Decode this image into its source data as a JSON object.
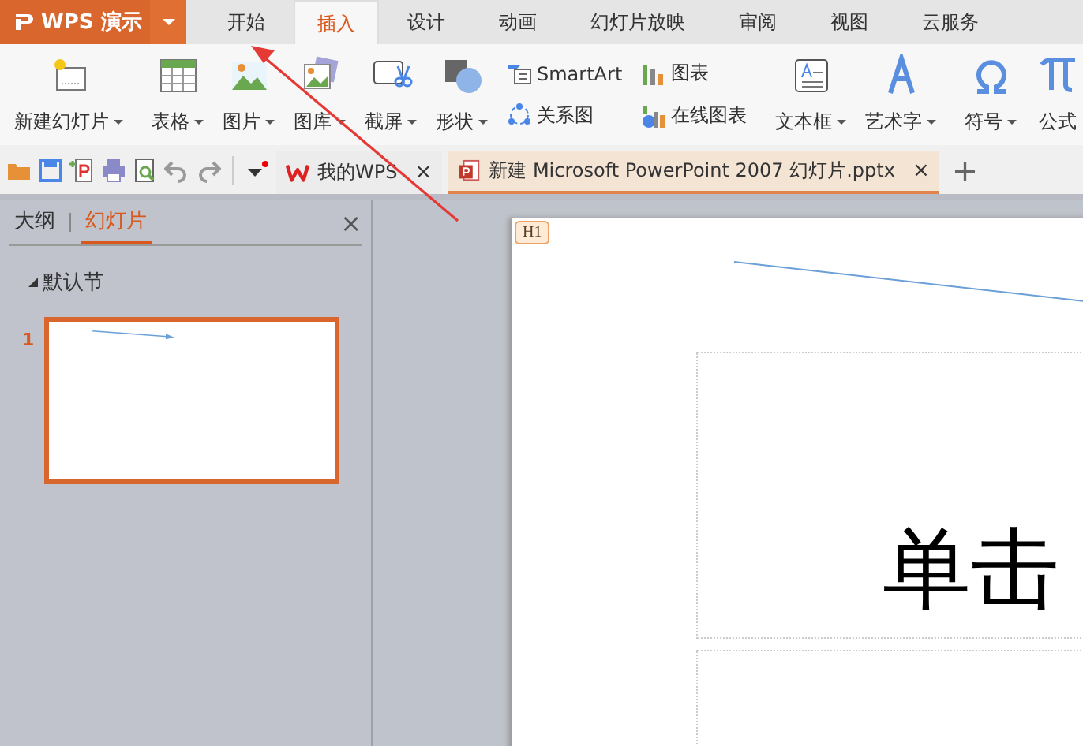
{
  "app_button": {
    "label": "WPS 演示",
    "has_menu": true
  },
  "menu_tabs": [
    {
      "label": "开始",
      "selected": false
    },
    {
      "label": "插入",
      "selected": true
    },
    {
      "label": "设计",
      "selected": false
    },
    {
      "label": "动画",
      "selected": false
    },
    {
      "label": "幻灯片放映",
      "selected": false
    },
    {
      "label": "审阅",
      "selected": false
    },
    {
      "label": "视图",
      "selected": false
    },
    {
      "label": "云服务",
      "selected": false
    }
  ],
  "ribbon": {
    "groups": [
      {
        "items": [
          {
            "kind": "large",
            "label": "新建幻灯片",
            "has_menu": true
          }
        ]
      },
      {
        "items": [
          {
            "kind": "large",
            "label": "表格",
            "has_menu": true
          },
          {
            "kind": "large",
            "label": "图片",
            "has_menu": true
          },
          {
            "kind": "large",
            "label": "图库",
            "has_menu": true
          },
          {
            "kind": "large",
            "label": "截屏",
            "has_menu": true
          },
          {
            "kind": "large",
            "label": "形状",
            "has_menu": true
          },
          {
            "kind": "stack",
            "items": [
              {
                "label": "SmartArt"
              },
              {
                "label": "关系图"
              }
            ]
          },
          {
            "kind": "stack",
            "items": [
              {
                "label": "图表"
              },
              {
                "label": "在线图表"
              }
            ]
          }
        ]
      },
      {
        "items": [
          {
            "kind": "large",
            "label": "文本框",
            "has_menu": true
          },
          {
            "kind": "large",
            "label": "艺术字",
            "has_menu": true
          }
        ]
      },
      {
        "items": [
          {
            "kind": "large",
            "label": "符号",
            "has_menu": true
          },
          {
            "kind": "large",
            "label": "公式",
            "has_menu": false
          }
        ]
      }
    ]
  },
  "doc_tabs": [
    {
      "label": "我的WPS",
      "selected": false,
      "close": "×"
    },
    {
      "label": "新建 Microsoft PowerPoint 2007 幻灯片.pptx",
      "selected": true,
      "close": "×"
    }
  ],
  "new_tab": "+",
  "side_panel": {
    "tabs": [
      {
        "label": "大纲",
        "selected": false
      },
      {
        "label": "幻灯片",
        "selected": true
      }
    ],
    "close": "×",
    "section": {
      "label": "默认节",
      "expanded": true
    },
    "slides": [
      {
        "number": "1",
        "selected": true
      }
    ]
  },
  "slide": {
    "badge": "H1",
    "title": "单击"
  }
}
